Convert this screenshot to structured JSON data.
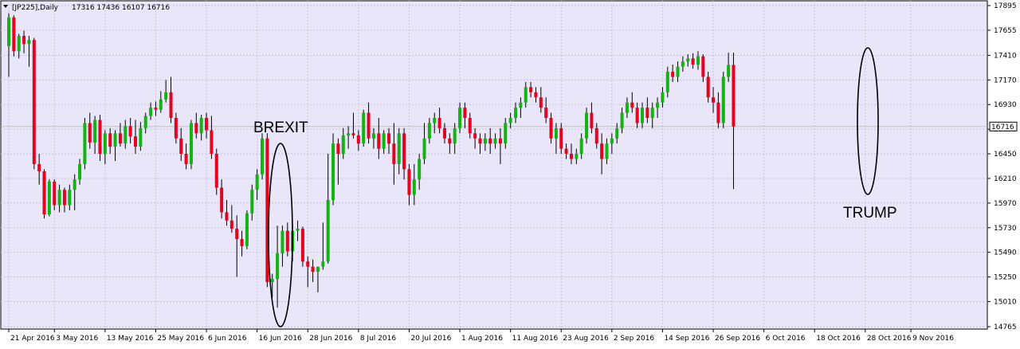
{
  "header": {
    "symbol_timeframe": "[JP225],Daily",
    "ohlc": "17316 17436 16107 16716",
    "dropdown_icon": "triangle-down-icon"
  },
  "colors": {
    "background": "#e8e6f8",
    "grid": "#c5c3d8",
    "bull": "#12b312",
    "bear": "#e8001e",
    "wick": "#000000",
    "price_line": "#c0c0c0"
  },
  "chart_data": {
    "type": "candlestick",
    "title": "",
    "xlabel": "",
    "ylabel": "",
    "ylim": [
      14765,
      17895
    ],
    "grid": true,
    "y_ticks": [
      17895,
      17655,
      17410,
      17170,
      16930,
      16690,
      16450,
      16210,
      15970,
      15730,
      15490,
      15250,
      15010,
      14765
    ],
    "x_ticks": [
      {
        "index": 0,
        "label": "21 Apr 2016"
      },
      {
        "index": 9,
        "label": "3 May 2016"
      },
      {
        "index": 19,
        "label": "13 May 2016"
      },
      {
        "index": 29,
        "label": "25 May 2016"
      },
      {
        "index": 39,
        "label": "6 Jun 2016"
      },
      {
        "index": 49,
        "label": "16 Jun 2016"
      },
      {
        "index": 59,
        "label": "28 Jun 2016"
      },
      {
        "index": 69,
        "label": "8 Jul 2016"
      },
      {
        "index": 79,
        "label": "20 Jul 2016"
      },
      {
        "index": 89,
        "label": "1 Aug 2016"
      },
      {
        "index": 99,
        "label": "11 Aug 2016"
      },
      {
        "index": 109,
        "label": "23 Aug 2016"
      },
      {
        "index": 119,
        "label": "2 Sep 2016"
      },
      {
        "index": 129,
        "label": "14 Sep 2016"
      },
      {
        "index": 139,
        "label": "26 Sep 2016"
      },
      {
        "index": 149,
        "label": "6 Oct 2016"
      },
      {
        "index": 159,
        "label": "18 Oct 2016"
      },
      {
        "index": 169,
        "label": "28 Oct 2016"
      },
      {
        "index": 178,
        "label": "9 Nov 2016"
      }
    ],
    "current_price": 16716,
    "annotations": [
      {
        "text": "BREXIT",
        "index": 57
      },
      {
        "text": "TRUMP",
        "index": 179
      }
    ],
    "ohlc": [
      [
        17500,
        17820,
        17200,
        17780
      ],
      [
        17780,
        17800,
        17400,
        17450
      ],
      [
        17450,
        17620,
        17380,
        17600
      ],
      [
        17600,
        17650,
        17430,
        17520
      ],
      [
        17520,
        17600,
        17300,
        17560
      ],
      [
        17560,
        17580,
        16300,
        16350
      ],
      [
        16350,
        16450,
        16150,
        16280
      ],
      [
        16280,
        16300,
        15820,
        15860
      ],
      [
        15860,
        16200,
        15840,
        16180
      ],
      [
        16180,
        16200,
        15900,
        15950
      ],
      [
        15950,
        16150,
        15880,
        16100
      ],
      [
        16100,
        16120,
        15880,
        15950
      ],
      [
        15950,
        16150,
        15900,
        16100
      ],
      [
        16100,
        16250,
        15900,
        16200
      ],
      [
        16200,
        16400,
        16150,
        16350
      ],
      [
        16350,
        16800,
        16300,
        16750
      ],
      [
        16750,
        16850,
        16500,
        16560
      ],
      [
        16560,
        16820,
        16450,
        16780
      ],
      [
        16780,
        16830,
        16380,
        16450
      ],
      [
        16450,
        16680,
        16350,
        16650
      ],
      [
        16650,
        16700,
        16450,
        16520
      ],
      [
        16520,
        16680,
        16380,
        16650
      ],
      [
        16650,
        16750,
        16520,
        16550
      ],
      [
        16550,
        16780,
        16500,
        16720
      ],
      [
        16720,
        16800,
        16550,
        16620
      ],
      [
        16620,
        16780,
        16450,
        16520
      ],
      [
        16520,
        16760,
        16480,
        16700
      ],
      [
        16700,
        16850,
        16650,
        16820
      ],
      [
        16820,
        16950,
        16780,
        16900
      ],
      [
        16900,
        16960,
        16820,
        16880
      ],
      [
        16880,
        17060,
        16850,
        16980
      ],
      [
        16980,
        17170,
        16950,
        17050
      ],
      [
        17050,
        17200,
        16750,
        16800
      ],
      [
        16800,
        16850,
        16550,
        16600
      ],
      [
        16600,
        16700,
        16380,
        16450
      ],
      [
        16450,
        16550,
        16300,
        16350
      ],
      [
        16350,
        16780,
        16300,
        16750
      ],
      [
        16750,
        16850,
        16600,
        16650
      ],
      [
        16650,
        16830,
        16580,
        16800
      ],
      [
        16800,
        16850,
        16600,
        16680
      ],
      [
        16680,
        16820,
        16400,
        16450
      ],
      [
        16450,
        16500,
        16050,
        16120
      ],
      [
        16120,
        16200,
        15820,
        15880
      ],
      [
        15880,
        16000,
        15750,
        15800
      ],
      [
        15800,
        15950,
        15680,
        15720
      ],
      [
        15720,
        15850,
        15250,
        15620
      ],
      [
        15620,
        15700,
        15450,
        15550
      ],
      [
        15550,
        15900,
        15520,
        15870
      ],
      [
        15870,
        16150,
        15800,
        16100
      ],
      [
        16100,
        16300,
        16000,
        16250
      ],
      [
        16250,
        16650,
        16200,
        16600
      ],
      [
        16600,
        16650,
        15150,
        15200
      ],
      [
        15200,
        15280,
        15050,
        15230
      ],
      [
        15230,
        15750,
        14950,
        15480
      ],
      [
        15480,
        15750,
        15350,
        15700
      ],
      [
        15700,
        15780,
        15450,
        15500
      ],
      [
        15500,
        15760,
        15400,
        15700
      ],
      [
        15700,
        15800,
        15600,
        15720
      ],
      [
        15720,
        15740,
        15350,
        15400
      ],
      [
        15400,
        15450,
        15150,
        15350
      ],
      [
        15350,
        15420,
        15200,
        15300
      ],
      [
        15300,
        15350,
        15100,
        15350
      ],
      [
        15350,
        15780,
        15320,
        15400
      ],
      [
        15400,
        16450,
        15380,
        16000
      ],
      [
        16000,
        16650,
        15950,
        16550
      ],
      [
        16550,
        16600,
        16150,
        16450
      ],
      [
        16450,
        16700,
        16400,
        16630
      ],
      [
        16630,
        16720,
        16500,
        16650
      ],
      [
        16650,
        16850,
        16600,
        16630
      ],
      [
        16630,
        16680,
        16480,
        16550
      ],
      [
        16550,
        16880,
        16520,
        16850
      ],
      [
        16850,
        16950,
        16550,
        16600
      ],
      [
        16600,
        16700,
        16500,
        16650
      ],
      [
        16650,
        16800,
        16400,
        16500
      ],
      [
        16500,
        16680,
        16450,
        16650
      ],
      [
        16650,
        16700,
        16450,
        16550
      ],
      [
        16550,
        16750,
        16150,
        16350
      ],
      [
        16350,
        16700,
        16250,
        16650
      ],
      [
        16650,
        16700,
        16200,
        16300
      ],
      [
        16300,
        16350,
        15950,
        16050
      ],
      [
        16050,
        16350,
        15950,
        16200
      ],
      [
        16200,
        16450,
        16100,
        16400
      ],
      [
        16400,
        16750,
        16350,
        16600
      ],
      [
        16600,
        16800,
        16550,
        16750
      ],
      [
        16750,
        16850,
        16650,
        16800
      ],
      [
        16800,
        16900,
        16650,
        16700
      ],
      [
        16700,
        16750,
        16550,
        16600
      ],
      [
        16600,
        16650,
        16450,
        16550
      ],
      [
        16550,
        16750,
        16450,
        16700
      ],
      [
        16700,
        16950,
        16650,
        16900
      ],
      [
        16900,
        16950,
        16700,
        16800
      ],
      [
        16800,
        16850,
        16600,
        16650
      ],
      [
        16650,
        16700,
        16500,
        16600
      ],
      [
        16600,
        16650,
        16450,
        16550
      ],
      [
        16550,
        16650,
        16480,
        16600
      ],
      [
        16600,
        16700,
        16450,
        16550
      ],
      [
        16550,
        16650,
        16500,
        16600
      ],
      [
        16600,
        16700,
        16350,
        16550
      ],
      [
        16550,
        16800,
        16500,
        16750
      ],
      [
        16750,
        16850,
        16700,
        16800
      ],
      [
        16800,
        16950,
        16750,
        16900
      ],
      [
        16900,
        17000,
        16800,
        16950
      ],
      [
        16950,
        17150,
        16900,
        17100
      ],
      [
        17100,
        17150,
        17000,
        17050
      ],
      [
        17050,
        17100,
        16950,
        17000
      ],
      [
        17000,
        17100,
        16850,
        16900
      ],
      [
        16900,
        17000,
        16750,
        16800
      ],
      [
        16800,
        16850,
        16550,
        16600
      ],
      [
        16600,
        16750,
        16450,
        16700
      ],
      [
        16700,
        16750,
        16450,
        16500
      ],
      [
        16500,
        16550,
        16400,
        16450
      ],
      [
        16450,
        16550,
        16350,
        16400
      ],
      [
        16400,
        16500,
        16350,
        16450
      ],
      [
        16450,
        16650,
        16400,
        16600
      ],
      [
        16600,
        16900,
        16550,
        16850
      ],
      [
        16850,
        16950,
        16650,
        16700
      ],
      [
        16700,
        16750,
        16500,
        16550
      ],
      [
        16550,
        16650,
        16250,
        16400
      ],
      [
        16400,
        16600,
        16350,
        16550
      ],
      [
        16550,
        16650,
        16450,
        16600
      ],
      [
        16600,
        16750,
        16550,
        16700
      ],
      [
        16700,
        16900,
        16650,
        16850
      ],
      [
        16850,
        17000,
        16800,
        16950
      ],
      [
        16950,
        17050,
        16850,
        16900
      ],
      [
        16900,
        16950,
        16700,
        16750
      ],
      [
        16750,
        16950,
        16700,
        16900
      ],
      [
        16900,
        17000,
        16750,
        16800
      ],
      [
        16800,
        16950,
        16700,
        16900
      ],
      [
        16900,
        17000,
        16800,
        16950
      ],
      [
        16950,
        17100,
        16900,
        17050
      ],
      [
        17050,
        17300,
        17000,
        17250
      ],
      [
        17250,
        17320,
        17150,
        17200
      ],
      [
        17200,
        17350,
        17150,
        17300
      ],
      [
        17300,
        17400,
        17250,
        17350
      ],
      [
        17350,
        17420,
        17300,
        17380
      ],
      [
        17380,
        17430,
        17280,
        17320
      ],
      [
        17320,
        17450,
        17270,
        17400
      ],
      [
        17400,
        17420,
        17150,
        17200
      ],
      [
        17200,
        17250,
        16950,
        17000
      ],
      [
        17000,
        17100,
        16850,
        16950
      ],
      [
        16950,
        17050,
        16700,
        16750
      ],
      [
        16750,
        17250,
        16700,
        17200
      ],
      [
        17200,
        17436,
        17150,
        17316
      ],
      [
        17316,
        17436,
        16107,
        16716
      ]
    ]
  }
}
